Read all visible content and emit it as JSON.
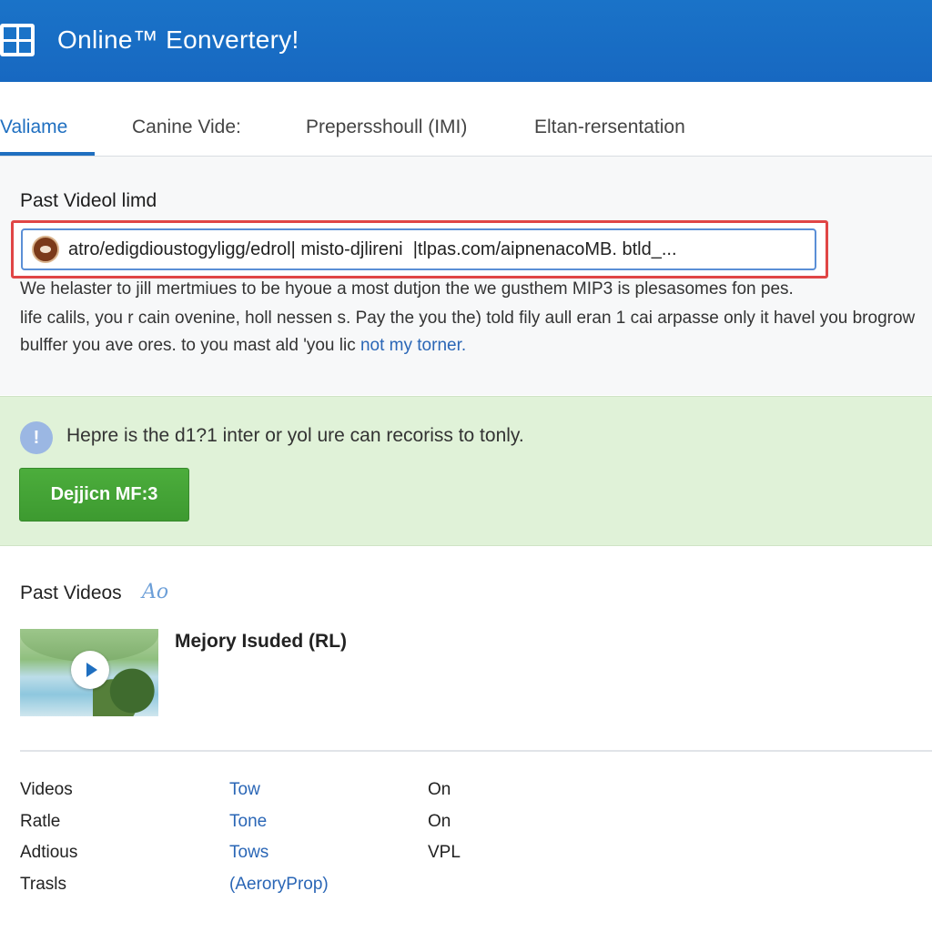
{
  "app": {
    "title": "Online™ Eonvertery!"
  },
  "tabs": [
    {
      "label": "Valiame",
      "active": true
    },
    {
      "label": "Canine Vide:"
    },
    {
      "label": "Prepersshoull (IMI)"
    },
    {
      "label": "Eltan-rersentation"
    }
  ],
  "url_section": {
    "label": "Past Videol limd",
    "input_value": "atro/edigdioustogyligg/edrol| misto-djlireni  |tlpas.com/aipnenacoMB. btld_..."
  },
  "description": {
    "line1": "We helaster to jill mertmiues to be hyoue a most dutjon the we gusthem MIP3 is plesasomes fon pes.",
    "line2": "life calils, you r cain ovenine, holl nessen s. Pay the you the) told fily aull eran 1 cai arpasse only it havel you brogrow",
    "line3_text": "bulffer you ave ores. to you mast ald 'you lic ",
    "line3_link": "not my torner."
  },
  "notice": {
    "icon": "info-icon",
    "text": "Hepre is the d1?1 inter or yol ure can recoriss to tonly.",
    "button_label": "Dejjicn MF:3"
  },
  "past_videos": {
    "header": "Past Videos",
    "badge": "Ao",
    "items": [
      {
        "title": "Mejory Isuded (RL)"
      }
    ]
  },
  "settings": [
    {
      "label": "Videos",
      "link": "Tow",
      "value": "On"
    },
    {
      "label": "Ratle",
      "link": "Tone",
      "value": "On"
    },
    {
      "label": "Adtious",
      "link": "Tows",
      "value": "VPL"
    },
    {
      "label": "Trasls",
      "link": "(AeroryProp)",
      "value": ""
    }
  ],
  "colors": {
    "header": "#1a73c8",
    "accent": "#1f6fc0",
    "notice_bg": "#e0f2d8",
    "button": "#44a436",
    "highlight_border": "#e04646"
  }
}
